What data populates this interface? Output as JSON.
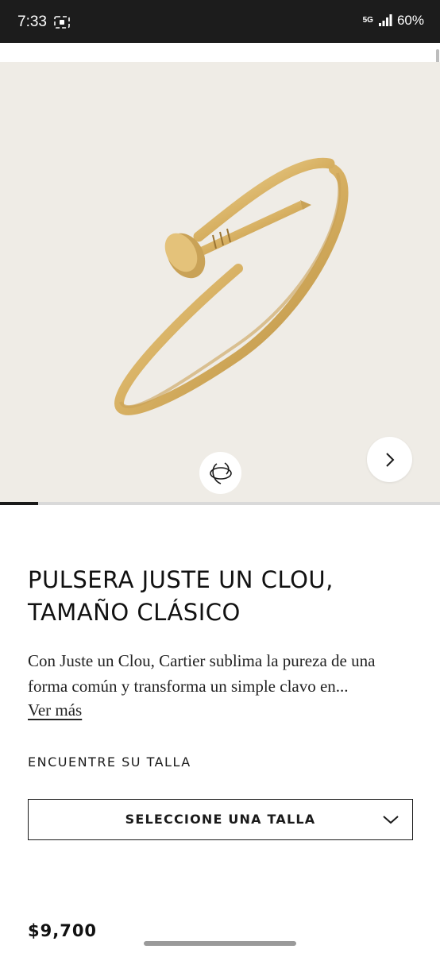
{
  "status_bar": {
    "time": "7:33",
    "network_label": "5G",
    "battery": "60%",
    "icons": [
      "screenshot-icon",
      "signal-icon"
    ]
  },
  "gallery": {
    "image_subject": "bracelet-image",
    "active_slide_fraction": 0.087,
    "accent": "#1a1a1a"
  },
  "product": {
    "title_line1": "PULSERA JUSTE UN CLOU,",
    "title_line2": "TAMAÑO CLÁSICO",
    "description_line1": "Con Juste un Clou, Cartier sublima la pureza de una",
    "description_line2": "forma común y transforma un simple clavo en...",
    "see_more": "Ver más",
    "size_label": "ENCUENTRE SU TALLA",
    "size_select": "SELECCIONE UNA TALLA",
    "price": "$9,700"
  },
  "colors": {
    "background": "#ffffff",
    "image_background": "#efece6",
    "text": "#1a1a1a",
    "gold": "#d9b56a"
  }
}
